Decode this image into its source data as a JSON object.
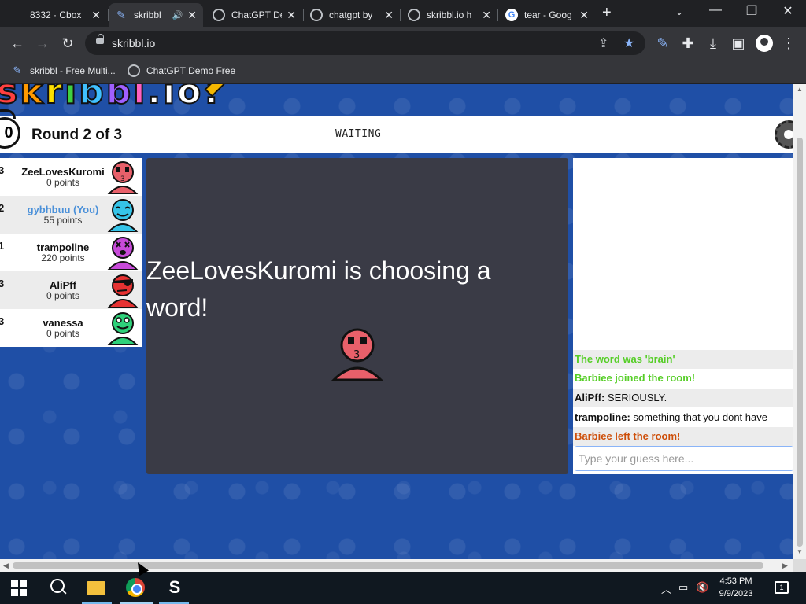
{
  "browser": {
    "tabs": [
      {
        "title": "8332 · Cbox",
        "icon": "globe-icon",
        "active": false
      },
      {
        "title": "skribbl",
        "icon": "quill-icon",
        "active": true,
        "audio": true
      },
      {
        "title": "ChatGPT De",
        "icon": "globe-icon",
        "active": false
      },
      {
        "title": "chatgpt by",
        "icon": "globe-icon",
        "active": false
      },
      {
        "title": "skribbl.io h",
        "icon": "globe-icon",
        "active": false
      },
      {
        "title": "tear - Goog",
        "icon": "google-icon",
        "active": false
      }
    ],
    "url": "skribbl.io",
    "bookmarks": [
      {
        "label": "skribbl - Free Multi...",
        "icon": "quill-icon"
      },
      {
        "label": "ChatGPT Demo Free",
        "icon": "globe-icon"
      }
    ]
  },
  "game": {
    "logo": "SKRIBBL.IO!",
    "timer": "0",
    "round_text": "Round 2 of 3",
    "state": "WAITING",
    "players": [
      {
        "rank": "3",
        "name": "ZeeLovesKuromi",
        "points": "0 points",
        "color": "#e8606a",
        "is_you": false
      },
      {
        "rank": "2",
        "name": "gybhbuu (You)",
        "points": "55 points",
        "color": "#36c4e8",
        "is_you": true
      },
      {
        "rank": "1",
        "name": "trampoline",
        "points": "220 points",
        "color": "#c74ad9",
        "is_you": false
      },
      {
        "rank": "3",
        "name": "AliPff",
        "points": "0 points",
        "color": "#e63232",
        "is_you": false
      },
      {
        "rank": "3",
        "name": "vanessa",
        "points": "0 points",
        "color": "#2ed17a",
        "is_you": false
      }
    ],
    "canvas_message": "ZeeLovesKuromi is choosing a word!",
    "chat": [
      {
        "type": "system-green",
        "text": "The word was 'brain'"
      },
      {
        "type": "system-green",
        "text": "Barbiee joined the room!"
      },
      {
        "type": "user",
        "who": "AliPff:",
        "text": " SERIOUSLY."
      },
      {
        "type": "user",
        "who": "trampoline:",
        "text": " something that you dont have"
      },
      {
        "type": "system-red",
        "text": "Barbiee left the room!"
      }
    ],
    "guess_placeholder": "Type your guess here..."
  },
  "taskbar": {
    "time": "4:53 PM",
    "date": "9/9/2023",
    "notifications": "1"
  },
  "colors": {
    "page_bg": "#1f4fa6",
    "canvas_bg": "#3a3b46",
    "green_msg": "#56ce27",
    "red_msg": "#ce4f0a",
    "you_name": "#4a90d9"
  }
}
